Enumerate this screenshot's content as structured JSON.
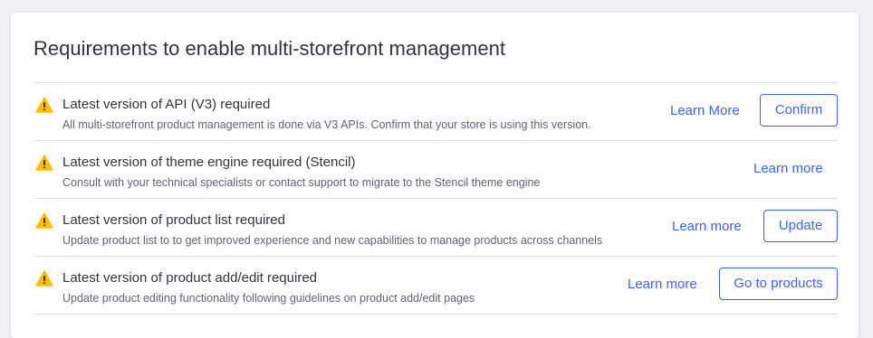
{
  "page": {
    "title": "Requirements to enable multi-storefront management"
  },
  "colors": {
    "accent": "#3c64f4",
    "warning": "#ffbf00",
    "text_primary": "#313440",
    "text_secondary": "#5e637a"
  },
  "requirements": [
    {
      "icon": "warning-icon",
      "title": "Latest version of API (V3) required",
      "description": "All multi-storefront product management is done via V3 APIs. Confirm that your store is using this version.",
      "learn_label": "Learn More",
      "action_label": "Confirm"
    },
    {
      "icon": "warning-icon",
      "title": "Latest version of theme engine required (Stencil)",
      "description": "Consult with your technical specialists or contact support to migrate to the Stencil theme engine",
      "learn_label": "Learn more"
    },
    {
      "icon": "warning-icon",
      "title": "Latest version of product list required",
      "description": "Update product list to to get improved experience and new capabilities to manage products across channels",
      "learn_label": "Learn more",
      "action_label": "Update"
    },
    {
      "icon": "warning-icon",
      "title": "Latest version of product add/edit required",
      "description": "Update product editing functionality following guidelines on product add/edit pages",
      "learn_label": "Learn more",
      "action_label": "Go to products"
    }
  ]
}
